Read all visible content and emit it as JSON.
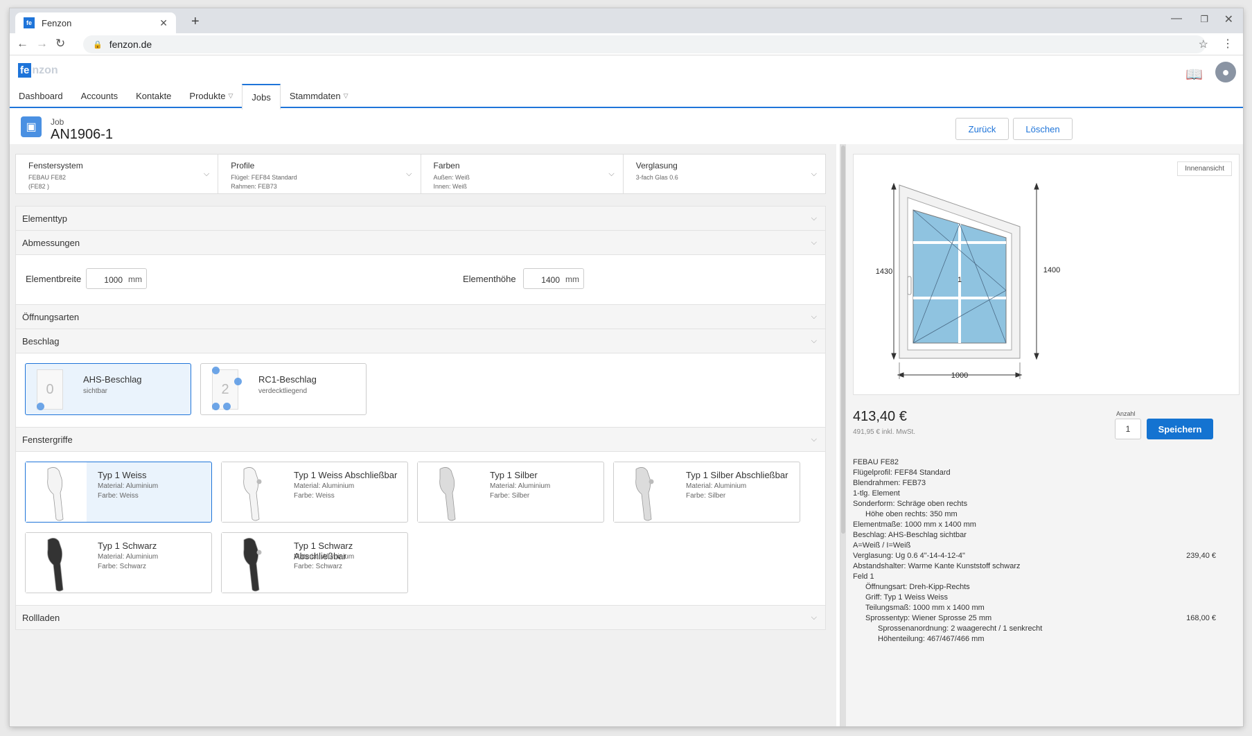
{
  "browser": {
    "tab_title": "Fenzon",
    "favicon": "fe",
    "url": "fenzon.de"
  },
  "app": {
    "logo_fe": "fe",
    "logo_rest": "nzon"
  },
  "nav": [
    {
      "label": "Dashboard",
      "dropdown": false,
      "active": false
    },
    {
      "label": "Accounts",
      "dropdown": false,
      "active": false
    },
    {
      "label": "Kontakte",
      "dropdown": false,
      "active": false
    },
    {
      "label": "Produkte",
      "dropdown": true,
      "active": false
    },
    {
      "label": "Jobs",
      "dropdown": false,
      "active": true
    },
    {
      "label": "Stammdaten",
      "dropdown": true,
      "active": false
    }
  ],
  "job": {
    "label": "Job",
    "id": "AN1906-1",
    "back": "Zurück",
    "delete": "Löschen"
  },
  "config": [
    {
      "title": "Fenstersystem",
      "lines": [
        "FEBAU FE82",
        "(FE82 )"
      ]
    },
    {
      "title": "Profile",
      "lines": [
        "Flügel: FEF84 Standard",
        "Rahmen: FEB73"
      ]
    },
    {
      "title": "Farben",
      "lines": [
        "Außen: Weiß",
        "Innen: Weiß"
      ]
    },
    {
      "title": "Verglasung",
      "lines": [
        "3-fach Glas 0.6"
      ]
    }
  ],
  "sections": {
    "elementtyp": "Elementtyp",
    "abmessungen": "Abmessungen",
    "oeffnungsarten": "Öffnungsarten",
    "beschlag": "Beschlag",
    "fenstergriffe": "Fenstergriffe",
    "rollladen": "Rollladen"
  },
  "dimensions": {
    "breite_label": "Elementbreite",
    "breite": "1000",
    "hoehe_label": "Elementhöhe",
    "hoehe": "1400",
    "unit": "mm"
  },
  "beschlag": [
    {
      "name": "AHS-Beschlag",
      "sub": "sichtbar",
      "num": "0"
    },
    {
      "name": "RC1-Beschlag",
      "sub": "verdecktliegend",
      "num": "2"
    }
  ],
  "griffe": [
    {
      "name": "Typ 1 Weiss",
      "material": "Material: Aluminium",
      "farbe": "Farbe: Weiss",
      "color": "#f4f4f4"
    },
    {
      "name": "Typ 1 Weiss Abschließbar",
      "material": "Material: Aluminium",
      "farbe": "Farbe: Weiss",
      "color": "#f4f4f4"
    },
    {
      "name": "Typ 1 Silber",
      "material": "Material: Aluminium",
      "farbe": "Farbe: Silber",
      "color": "#dcdcdc"
    },
    {
      "name": "Typ 1 Silber Abschließbar",
      "material": "Material: Aluminium",
      "farbe": "Farbe: Silber",
      "color": "#dcdcdc"
    },
    {
      "name": "Typ 1 Schwarz",
      "material": "Material: Aluminium",
      "farbe": "Farbe: Schwarz",
      "color": "#333333"
    },
    {
      "name": "Typ 1 Schwarz Abschließbar",
      "material": "Material: Aluminium",
      "farbe": "Farbe: Schwarz",
      "color": "#333333"
    }
  ],
  "preview": {
    "view_label": "Innenansicht",
    "dim_left": "1430",
    "dim_right": "1400",
    "dim_bottom": "1000",
    "field_no": "1"
  },
  "price": {
    "total": "413,40 €",
    "gross": "491,95 € inkl. MwSt.",
    "qty_label": "Anzahl",
    "qty": "1",
    "save": "Speichern"
  },
  "summary": [
    {
      "t": "FEBAU FE82",
      "p": "",
      "i": 0
    },
    {
      "t": "Flügelprofil: FEF84 Standard",
      "p": "",
      "i": 0
    },
    {
      "t": "Blendrahmen: FEB73",
      "p": "",
      "i": 0
    },
    {
      "t": "1-tlg. Element",
      "p": "",
      "i": 0
    },
    {
      "t": "Sonderform: Schräge oben rechts",
      "p": "",
      "i": 0
    },
    {
      "t": "Höhe oben rechts: 350 mm",
      "p": "",
      "i": 1
    },
    {
      "t": "Elementmaße: 1000 mm x 1400 mm",
      "p": "",
      "i": 0
    },
    {
      "t": "Beschlag: AHS-Beschlag sichtbar",
      "p": "",
      "i": 0
    },
    {
      "t": "A=Weiß / I=Weiß",
      "p": "",
      "i": 0
    },
    {
      "t": "Verglasung: Ug 0.6 4\"-14-4-12-4\"",
      "p": "239,40 €",
      "i": 0
    },
    {
      "t": "Abstandshalter: Warme Kante Kunststoff schwarz",
      "p": "",
      "i": 0
    },
    {
      "t": "Feld 1",
      "p": "",
      "i": 0
    },
    {
      "t": "Öffnungsart: Dreh-Kipp-Rechts",
      "p": "",
      "i": 1
    },
    {
      "t": "Griff: Typ 1 Weiss Weiss",
      "p": "",
      "i": 1
    },
    {
      "t": "Teilungsmaß: 1000 mm x 1400 mm",
      "p": "",
      "i": 1
    },
    {
      "t": "Sprossentyp: Wiener Sprosse 25 mm",
      "p": "168,00 €",
      "i": 1
    },
    {
      "t": "Sprossenanordnung: 2 waagerecht / 1 senkrecht",
      "p": "",
      "i": 2
    },
    {
      "t": "Höhenteilung: 467/467/466 mm",
      "p": "",
      "i": 2
    }
  ]
}
